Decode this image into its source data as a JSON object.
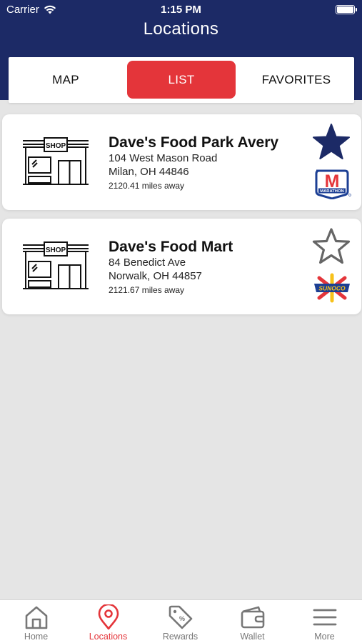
{
  "status_bar": {
    "carrier": "Carrier",
    "time": "1:15 PM"
  },
  "header": {
    "title": "Locations"
  },
  "segments": [
    {
      "label": "MAP",
      "selected": false
    },
    {
      "label": "LIST",
      "selected": true
    },
    {
      "label": "FAVORITES",
      "selected": false
    }
  ],
  "locations": [
    {
      "name": "Dave's Food Park Avery",
      "address_line1": "104 West Mason Road",
      "address_line2": "Milan, OH  44846",
      "distance": "2120.41 miles away",
      "favorite": true,
      "brand": "MARATHON",
      "brand_letter": "M",
      "icon": "shop-storefront-icon"
    },
    {
      "name": "Dave's Food Mart",
      "address_line1": "84 Benedict Ave",
      "address_line2": "Norwalk, OH  44857",
      "distance": "2121.67 miles away",
      "favorite": false,
      "brand": "SUNOCO",
      "icon": "shop-storefront-icon"
    }
  ],
  "shop_sign": "SHOP",
  "tabs": [
    {
      "label": "Home",
      "icon": "home-icon",
      "active": false
    },
    {
      "label": "Locations",
      "icon": "location-pin-icon",
      "active": true
    },
    {
      "label": "Rewards",
      "icon": "rewards-tag-icon",
      "active": false
    },
    {
      "label": "Wallet",
      "icon": "wallet-icon",
      "active": false
    },
    {
      "label": "More",
      "icon": "menu-icon",
      "active": false
    }
  ],
  "colors": {
    "header": "#1c2a66",
    "accent": "#e4353a",
    "favorite_star": "#1c2a66",
    "inactive_star": "#666666"
  }
}
